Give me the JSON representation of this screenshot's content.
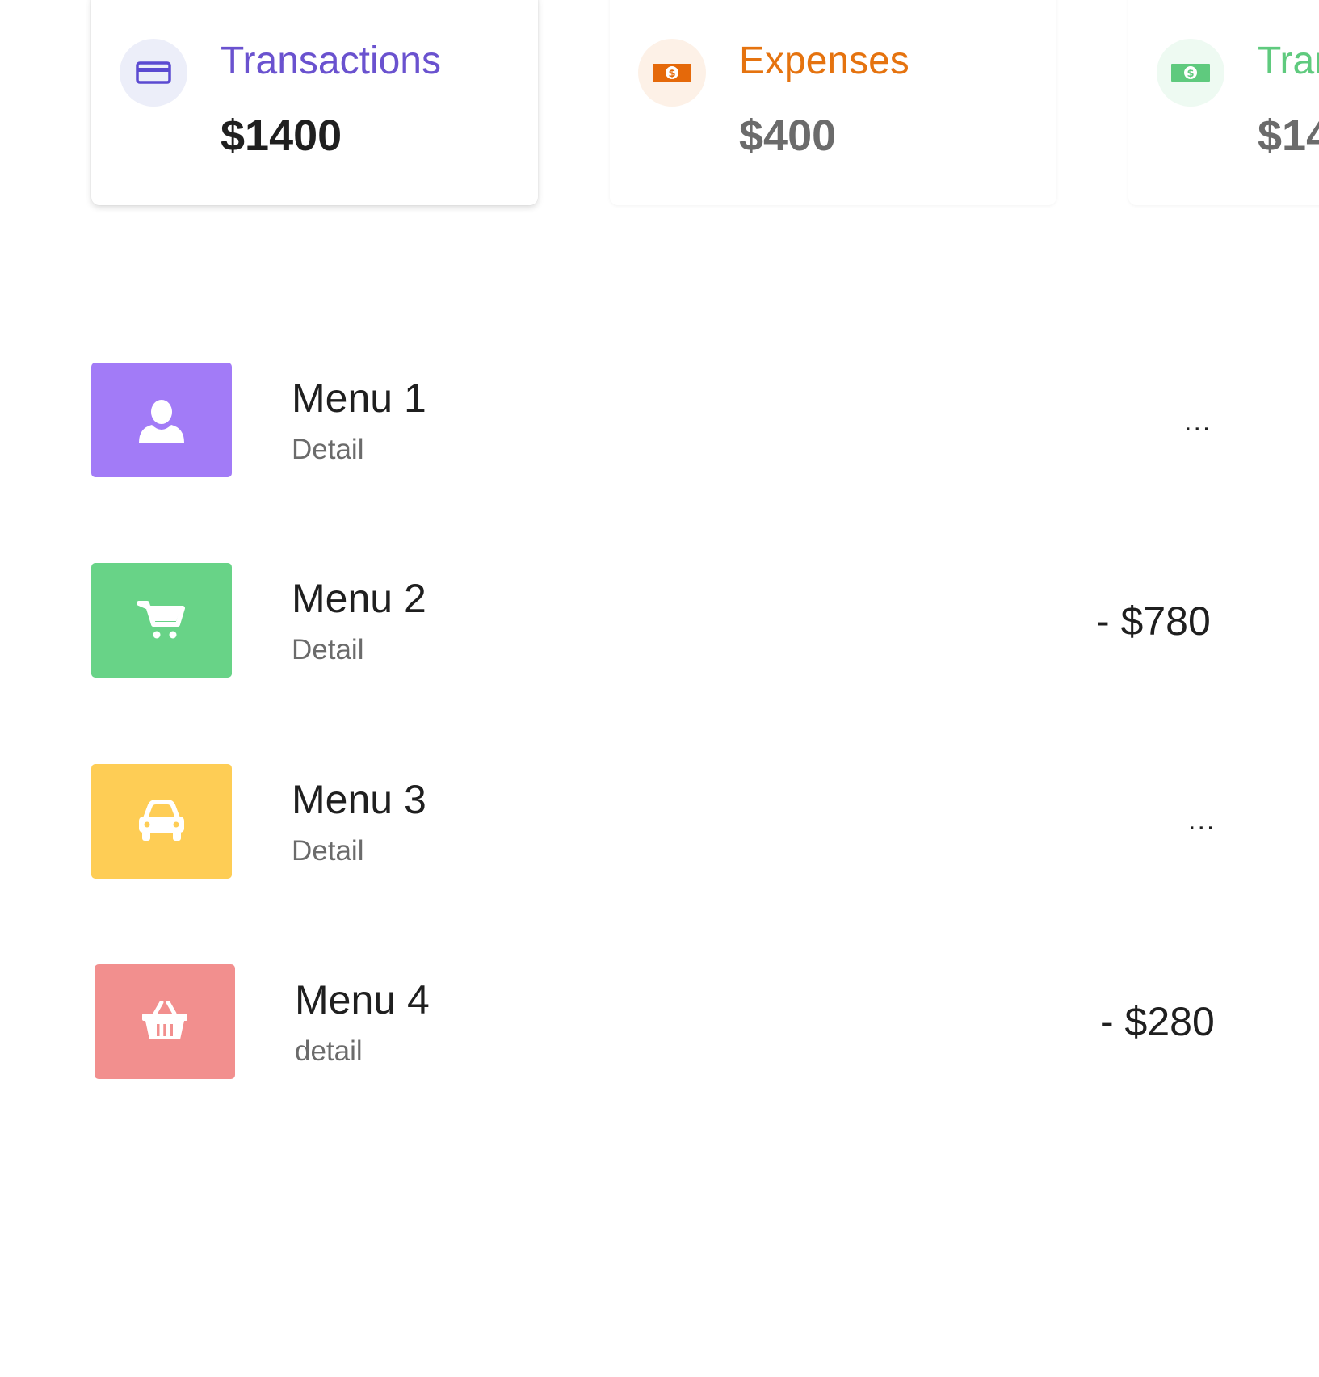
{
  "cards": [
    {
      "title": "Transactions",
      "value": "$1400",
      "icon": "credit-card-icon",
      "title_color": "#6a52cf",
      "value_color": "#1f1f1f",
      "icon_color": "#5b4ad1",
      "icon_bg": "#eceef9"
    },
    {
      "title": "Expenses",
      "value": "$400",
      "icon": "money-bill-icon",
      "title_color": "#e5730f",
      "value_color": "#6b6b6b",
      "icon_color": "#e5690a",
      "icon_bg": "#fdf1e7"
    },
    {
      "title": "Tran",
      "value": "$14",
      "icon": "money-bill-icon",
      "title_color": "#5fca7e",
      "value_color": "#6b6b6b",
      "icon_color": "#5fca7e",
      "icon_bg": "#eefaf2"
    }
  ],
  "menu": [
    {
      "title": "Menu 1",
      "detail": "Detail",
      "trailing": "...",
      "icon": "user-icon",
      "tile_color": "#a27bf7"
    },
    {
      "title": "Menu 2",
      "detail": "Detail",
      "trailing": "- $780",
      "icon": "shopping-cart-icon",
      "tile_color": "#68d387"
    },
    {
      "title": "Menu 3",
      "detail": "Detail",
      "trailing": "...",
      "icon": "car-icon",
      "tile_color": "#fecd55"
    },
    {
      "title": "Menu 4",
      "detail": "detail",
      "trailing": "- $280",
      "icon": "shopping-basket-icon",
      "tile_color": "#f28f8e"
    }
  ]
}
